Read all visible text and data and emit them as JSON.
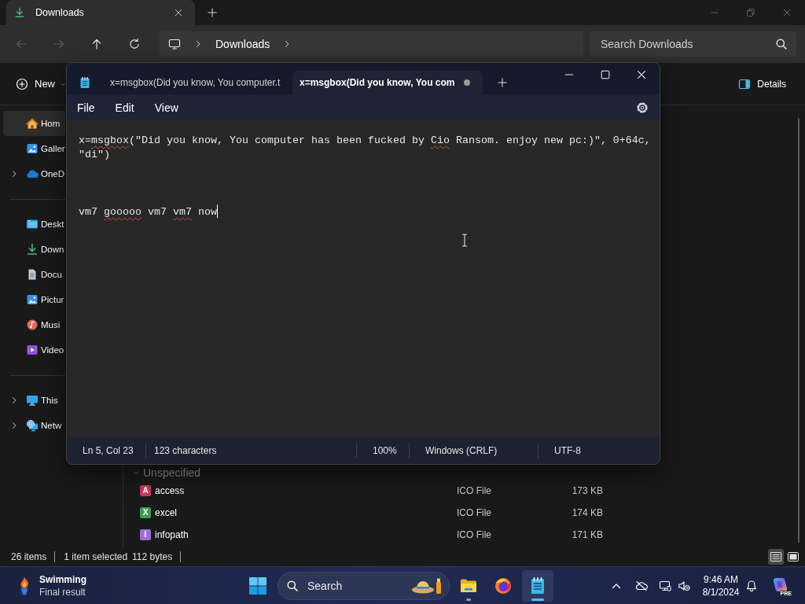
{
  "explorer": {
    "tabs": [
      {
        "label": "Downloads",
        "selected": true
      }
    ],
    "nav": [
      {
        "kind": "back",
        "disabled": true
      },
      {
        "kind": "forward",
        "disabled": true
      },
      {
        "kind": "up",
        "disabled": false
      },
      {
        "kind": "refresh",
        "disabled": false
      }
    ],
    "address": {
      "path": [
        "Downloads"
      ]
    },
    "search": {
      "placeholder": "Search Downloads"
    },
    "commands": {
      "new": "New",
      "details": "Details"
    },
    "sidebar": {
      "groups": [
        {
          "items": [
            {
              "kind": "home",
              "label": "Hom",
              "selected": true,
              "expandable": false
            },
            {
              "kind": "gallery",
              "label": "Galler",
              "selected": false,
              "expandable": false
            },
            {
              "kind": "onedrive",
              "label": "OneD",
              "selected": false,
              "expandable": true
            }
          ]
        },
        {
          "items": [
            {
              "kind": "desktop",
              "label": "Deskt",
              "selected": false,
              "expandable": false
            },
            {
              "kind": "downloads",
              "label": "Down",
              "selected": false,
              "expandable": false
            },
            {
              "kind": "documents",
              "label": "Docu",
              "selected": false,
              "expandable": false
            },
            {
              "kind": "pictures",
              "label": "Pictur",
              "selected": false,
              "expandable": false
            },
            {
              "kind": "music",
              "label": "Musi",
              "selected": false,
              "expandable": false
            },
            {
              "kind": "videos",
              "label": "Video",
              "selected": false,
              "expandable": false
            }
          ]
        },
        {
          "items": [
            {
              "kind": "thispc",
              "label": "This",
              "selected": false,
              "expandable": true
            },
            {
              "kind": "network",
              "label": "Netw",
              "selected": false,
              "expandable": true
            }
          ]
        }
      ]
    },
    "file_list": {
      "group": "Unspecified",
      "expanded": true,
      "rows": [
        {
          "icon": "A",
          "color": "#c8385c",
          "name": "access",
          "type": "ICO File",
          "size": "173 KB"
        },
        {
          "icon": "X",
          "color": "#3f9d52",
          "name": "excel",
          "type": "ICO File",
          "size": "174 KB"
        },
        {
          "icon": "I",
          "color": "#9b6fd6",
          "name": "infopath",
          "type": "ICO File",
          "size": "171 KB"
        }
      ]
    },
    "status_bar": {
      "count": "26 items",
      "selection": "1 item selected",
      "size": "112 bytes"
    },
    "views": [
      {
        "kind": "details",
        "selected": true
      },
      {
        "kind": "tiles",
        "selected": false
      }
    ]
  },
  "notepad": {
    "tabs": [
      {
        "label": "x=msgbox(Did you know, You computer.t",
        "selected": false,
        "unsaved": false
      },
      {
        "label": "x=msgbox(Did you know, You com",
        "selected": true,
        "unsaved": true
      }
    ],
    "menu": [
      "File",
      "Edit",
      "View"
    ],
    "lines": [
      {
        "segments": [
          {
            "text": "x=",
            "misspelled": false
          },
          {
            "text": "msgbox",
            "misspelled": true
          },
          {
            "text": "(\"Did you know, You computer has been fucked by ",
            "misspelled": false
          },
          {
            "text": "Cio",
            "misspelled": true
          },
          {
            "text": " Ransom. enjoy new pc:)\", 0+64c, \"di\")",
            "misspelled": false
          }
        ],
        "caret": false
      },
      {
        "caret": false
      },
      {
        "caret": false
      },
      {
        "caret": false
      },
      {
        "segments": [
          {
            "text": "vm7 ",
            "misspelled": false
          },
          {
            "text": "gooooo",
            "misspelled": true
          },
          {
            "text": " vm7 ",
            "misspelled": false
          },
          {
            "text": "vm7",
            "misspelled": true
          },
          {
            "text": " now",
            "misspelled": false
          }
        ],
        "caret": true
      }
    ],
    "status": {
      "position": "Ln 5, Col 23",
      "characters": "123 characters",
      "zoom": "100%",
      "line_ending": "Windows (CRLF)",
      "encoding": "UTF-8"
    }
  },
  "taskbar": {
    "widget": {
      "title": "Swimming",
      "subtitle": "Final result"
    },
    "search": {
      "placeholder": "Search"
    },
    "apps": [
      {
        "kind": "explorer",
        "running": true,
        "active": false
      },
      {
        "kind": "firefox",
        "running": false,
        "active": false
      },
      {
        "kind": "notepad",
        "running": true,
        "active": true
      }
    ],
    "clock": {
      "time": "9:46 AM",
      "date": "8/1/2024"
    },
    "copilot": {
      "badge": "PRE"
    }
  }
}
